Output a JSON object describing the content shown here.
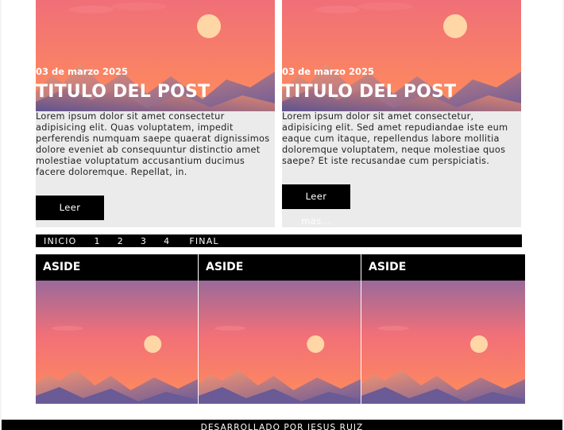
{
  "posts": [
    {
      "date": "03 de marzo 2025",
      "title": "TITULO DEL POST",
      "excerpt": "Lorem ipsum dolor sit amet consectetur adipisicing elit. Quas voluptatem, impedit perferendis numquam saepe quaerat dignissimos dolore eveniet ab consequuntur distinctio amet molestiae voluptatum accusantium ducimus facere doloremque. Repellat, in.",
      "read_more": "Leer mas..."
    },
    {
      "date": "03 de marzo 2025",
      "title": "TITULO DEL POST",
      "excerpt": "Lorem ipsum dolor sit amet consectetur, adipisicing elit. Sed amet repudiandae iste eum eaque cum itaque, repellendus labore mollitia doloremque voluptatem, neque molestiae quos saepe? Et iste recusandae cum perspiciatis.",
      "read_more": "Leer mas..."
    }
  ],
  "pagination": {
    "first": "INICIO",
    "pages": [
      "1",
      "2",
      "3",
      "4"
    ],
    "last": "FINAL"
  },
  "asides": [
    {
      "title": "ASIDE"
    },
    {
      "title": "ASIDE"
    },
    {
      "title": "ASIDE"
    }
  ],
  "footer": {
    "text": "DESARROLLADO POR JESUS RUIZ"
  },
  "colors": {
    "sky_top": "#f2747a",
    "sky_bottom": "#ff8a5c",
    "sun": "#ffd9a8",
    "dune_dark": "#6e5e9a",
    "dune_light": "#f08a6a"
  }
}
